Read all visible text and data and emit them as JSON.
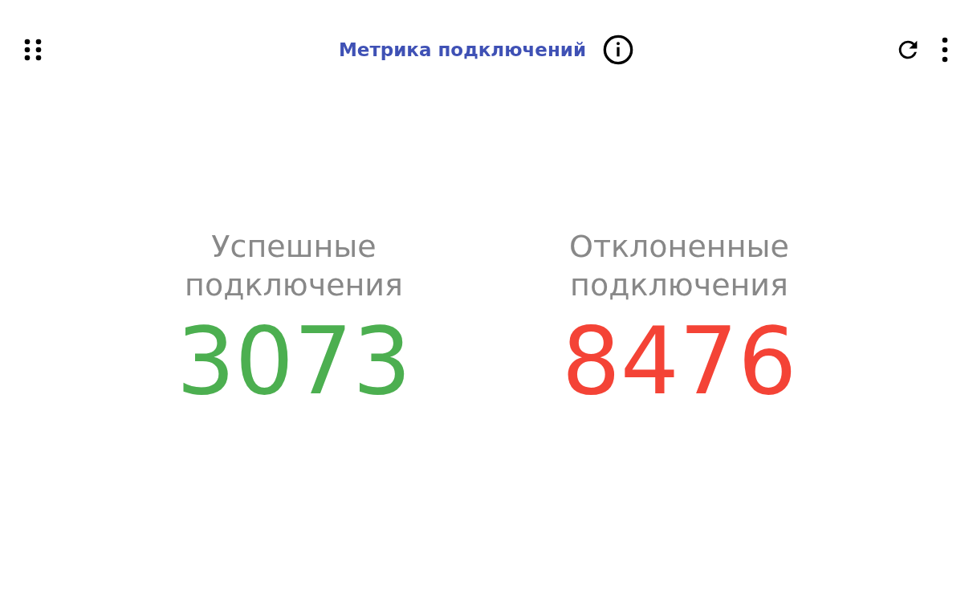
{
  "widget": {
    "title": "Метрика подключений"
  },
  "metrics": [
    {
      "label": "Успешные подключения",
      "value": "3073",
      "color": "#4caf50"
    },
    {
      "label": "Отклоненные подключения",
      "value": "8476",
      "color": "#f44336"
    }
  ]
}
